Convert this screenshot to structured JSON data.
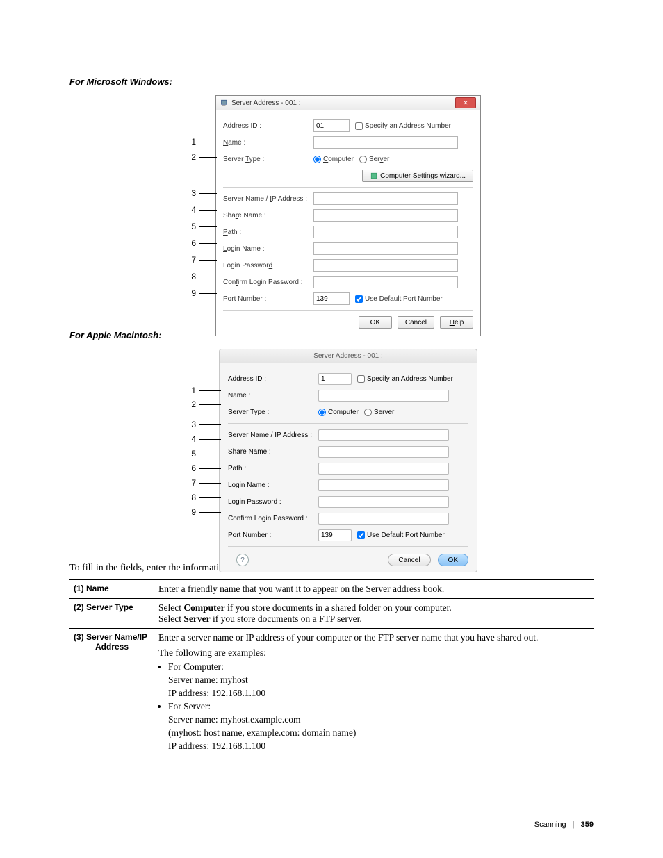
{
  "headings": {
    "win": "For Microsoft Windows:",
    "mac": "For Apple Macintosh:"
  },
  "win_dialog": {
    "title": "Server Address - 001 :",
    "labels": {
      "address_id_pre": "A",
      "address_id_u": "d",
      "address_id_post": "dress ID :",
      "specify_pre": "Sp",
      "specify_u": "e",
      "specify_post": "cify an Address Number",
      "name_u": "N",
      "name_post": "ame :",
      "server_type_pre": "Server ",
      "server_type_u": "T",
      "server_type_post": "ype :",
      "computer_u": "C",
      "computer_post": "omputer",
      "server_pre": "Ser",
      "server_u": "v",
      "server_post": "er",
      "wizard_pre": "Computer Settings ",
      "wizard_u": "w",
      "wizard_post": "izard...",
      "sn_pre": "Server Name / ",
      "sn_u": "I",
      "sn_post": "P Address :",
      "share_pre": "Sha",
      "share_u": "r",
      "share_post": "e Name :",
      "path_u": "P",
      "path_post": "ath :",
      "login_u": "L",
      "login_post": "ogin Name :",
      "pw_pre": "Login Passwor",
      "pw_u": "d",
      "confirm_pre": "Con",
      "confirm_u": "f",
      "confirm_post": "irm Login Password :",
      "port_pre": "Por",
      "port_u": "t",
      "port_post": " Number :",
      "defport_u": "U",
      "defport_post": "se Default Port Number",
      "ok": "OK",
      "cancel": "Cancel",
      "help_u": "H",
      "help_post": "elp"
    },
    "values": {
      "address_id": "01",
      "port": "139"
    }
  },
  "numbers": [
    "1",
    "2",
    "3",
    "4",
    "5",
    "6",
    "7",
    "8",
    "9"
  ],
  "mac_dialog": {
    "title": "Server Address - 001 :",
    "labels": {
      "address_id": "Address ID :",
      "specify": "Specify an Address Number",
      "name": "Name :",
      "server_type": "Server Type :",
      "computer": "Computer",
      "server": "Server",
      "sn": "Server Name / IP Address :",
      "share": "Share Name :",
      "path": "Path :",
      "login": "Login Name :",
      "pw": "Login Password :",
      "confirm": "Confirm Login Password :",
      "port": "Port Number :",
      "defport": "Use Default Port Number",
      "cancel": "Cancel",
      "ok": "OK"
    },
    "values": {
      "address_id": "1",
      "port": "139"
    }
  },
  "intro": "To fill in the fields, enter the information as follows:",
  "table": {
    "r1": {
      "num": "(1) Name",
      "desc": "Enter a friendly name that you want it to appear on the Server address book."
    },
    "r2": {
      "num": "(2) Server Type",
      "l1a": "Select ",
      "l1b": "Computer",
      "l1c": " if you store documents in a shared folder on your computer.",
      "l2a": "Select ",
      "l2b": "Server",
      "l2c": " if you store documents on a FTP server."
    },
    "r3": {
      "numA": "(3) Server Name/IP",
      "numB": "Address",
      "p1": "Enter a server name or IP address of your computer or the FTP server name that you have shared out.",
      "p2": "The following are examples:",
      "b1": "For Computer:",
      "b1a": "Server name: myhost",
      "b1b": "IP address: 192.168.1.100",
      "b2": "For Server:",
      "b2a": "Server name: myhost.example.com",
      "b2b": "(myhost: host name, example.com: domain name)",
      "b2c": "IP address: 192.168.1.100"
    }
  },
  "footer": {
    "label": "Scanning",
    "page": "359"
  }
}
